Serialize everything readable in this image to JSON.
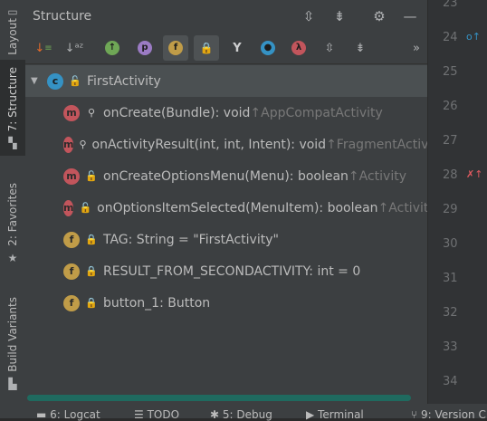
{
  "left_strip": {
    "tabs": [
      {
        "label": "Layout"
      },
      {
        "label": "7: Structure"
      },
      {
        "label": "2: Favorites"
      },
      {
        "label": "Build Variants"
      }
    ]
  },
  "header": {
    "title": "Structure",
    "buttons": [
      "expand-all",
      "collapse-all",
      "settings",
      "hide"
    ]
  },
  "toolbar": {
    "buttons": [
      {
        "name": "sort-by-visibility",
        "glyph": "↓"
      },
      {
        "name": "sort-alphabetically",
        "glyph": "↓"
      },
      {
        "name": "show-inherited",
        "glyph": "↑"
      },
      {
        "name": "show-properties",
        "glyph": "p"
      },
      {
        "name": "show-fields",
        "glyph": "f"
      },
      {
        "name": "show-non-public",
        "glyph": "🔒"
      },
      {
        "name": "show-anonymous",
        "glyph": "Y"
      },
      {
        "name": "show-interfaces",
        "glyph": "●"
      },
      {
        "name": "show-lambdas",
        "glyph": "λ"
      },
      {
        "name": "expand",
        "glyph": "⇕"
      },
      {
        "name": "collapse",
        "glyph": "⇣"
      },
      {
        "name": "more",
        "glyph": "»"
      }
    ]
  },
  "tree": {
    "root": {
      "name": "FirstActivity",
      "icon": "c"
    },
    "items": [
      {
        "icon": "m",
        "access": "prot",
        "name": "onCreate(Bundle): void ",
        "super": "↑AppCompatActivity"
      },
      {
        "icon": "m",
        "access": "prot",
        "name": "onActivityResult(int, int, Intent): void ",
        "super": "↑FragmentActivi"
      },
      {
        "icon": "m",
        "access": "pub",
        "name": "onCreateOptionsMenu(Menu): boolean ",
        "super": "↑Activity"
      },
      {
        "icon": "m",
        "access": "pub",
        "name": "onOptionsItemSelected(MenuItem): boolean ",
        "super": "↑Activity"
      },
      {
        "icon": "f",
        "access": "priv",
        "name": "TAG: String = \"FirstActivity\"",
        "super": ""
      },
      {
        "icon": "f",
        "access": "priv",
        "name": "RESULT_FROM_SECONDACTIVITY: int = 0",
        "super": ""
      },
      {
        "icon": "f",
        "access": "priv",
        "name": "button_1: Button",
        "super": ""
      }
    ]
  },
  "gutter": {
    "lines": [
      "23",
      "24",
      "25",
      "26",
      "27",
      "28",
      "29",
      "30",
      "31",
      "32",
      "33",
      "34"
    ]
  },
  "bottombar": {
    "tabs": [
      "6: Logcat",
      "TODO",
      "5: Debug",
      "Terminal",
      "9: Version C"
    ]
  }
}
